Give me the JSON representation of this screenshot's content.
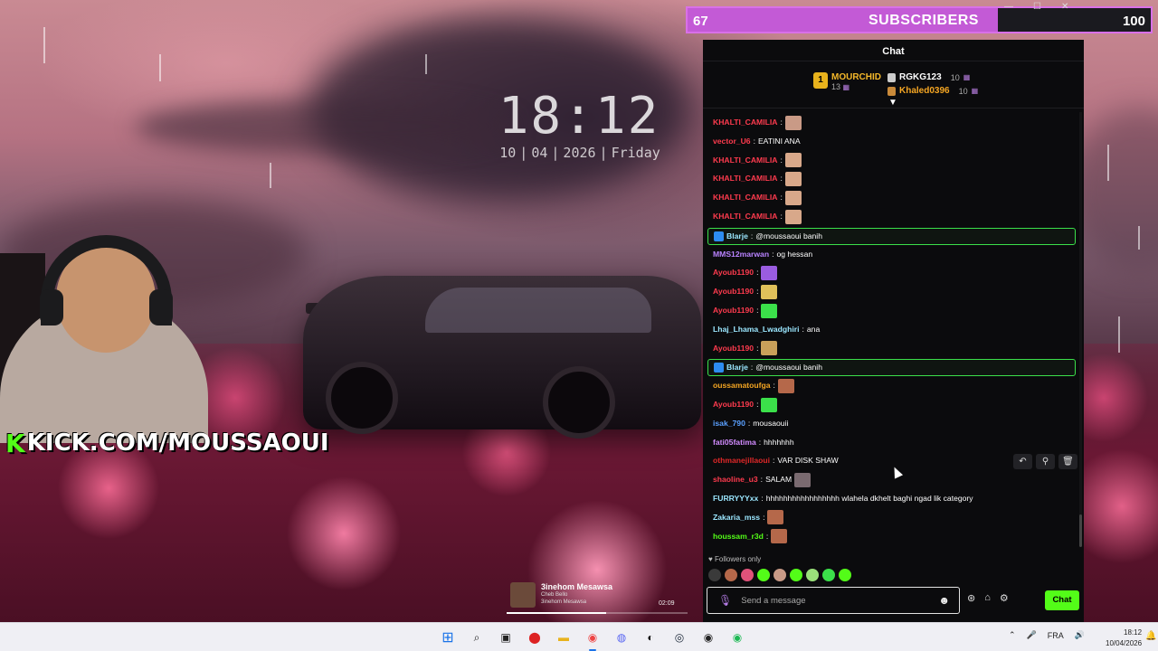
{
  "overlay": {
    "clock": {
      "time": "18:12",
      "day": "10",
      "month": "04",
      "year": "2026",
      "weekday": "Friday"
    },
    "brand": {
      "k_letter": "K",
      "text": "KICK.COM/MOUSSAOUI"
    },
    "sub_goal": {
      "current": "67",
      "label": "SUBSCRIBERS",
      "target": "100",
      "progress": 0.67
    },
    "music": {
      "title": "3inehom Mesawsa",
      "artist": "Cheb Bello",
      "album": "3inehom Mesawsa",
      "time": "02:09",
      "progress": 0.55
    }
  },
  "chat": {
    "header": "Chat",
    "leaderboard": {
      "first": {
        "rank": "1",
        "name": "MOURCHID",
        "count": "13",
        "color": "#f5b82a"
      },
      "second": {
        "name": "RGKG123",
        "count": "10",
        "color": "#ffffff"
      },
      "third": {
        "name": "Khaled0396",
        "count": "10",
        "color": "#f5a623"
      }
    },
    "messages": [
      {
        "user": "KHALTI_CAMILIA",
        "text": "",
        "color": "#ff3b4e",
        "emote": "#c99a86"
      },
      {
        "user": "vector_U6",
        "text": "EATINI ANA",
        "color": "#ff3b4e"
      },
      {
        "user": "KHALTI_CAMILIA",
        "text": "",
        "color": "#ff3b4e",
        "emote": "#d8a88a"
      },
      {
        "user": "KHALTI_CAMILIA",
        "text": "",
        "color": "#ff3b4e",
        "emote": "#d8a88a"
      },
      {
        "user": "KHALTI_CAMILIA",
        "text": "",
        "color": "#ff3b4e",
        "emote": "#d8a88a"
      },
      {
        "user": "KHALTI_CAMILIA",
        "text": "",
        "color": "#ff3b4e",
        "emote": "#d8a88a"
      },
      {
        "user": "Blarje",
        "text": "@moussaoui banih",
        "color": "#9be7ff",
        "highlight": true
      },
      {
        "user": "MMS12marwan",
        "text": "og hessan",
        "color": "#b983ff"
      },
      {
        "user": "Ayoub1190",
        "text": "",
        "color": "#ff3b4e",
        "emote": "#9a5ce0"
      },
      {
        "user": "Ayoub1190",
        "text": "",
        "color": "#ff3b4e",
        "emote": "#e0c05a"
      },
      {
        "user": "Ayoub1190",
        "text": "",
        "color": "#ff3b4e",
        "emote": "#3be04a"
      },
      {
        "user": "Lhaj_Lhama_Lwadghiri",
        "text": "ana",
        "color": "#9be7ff"
      },
      {
        "user": "Ayoub1190",
        "text": "",
        "color": "#ff3b4e",
        "emote": "#c9a05a"
      },
      {
        "user": "Blarje",
        "text": "@moussaoui banih",
        "color": "#9be7ff",
        "highlight": true
      },
      {
        "user": "oussamatoufga",
        "text": "",
        "color": "#f5a623",
        "emote": "#b5684a"
      },
      {
        "user": "Ayoub1190",
        "text": "",
        "color": "#ff3b4e",
        "emote": "#3be04a"
      },
      {
        "user": "isak_790",
        "text": "mousaouii",
        "color": "#5aa0ff"
      },
      {
        "user": "fati05fatima",
        "text": "hhhhhhh",
        "color": "#d28cff"
      },
      {
        "user": "othmanejillaoui",
        "text": "VAR DISK SHAW",
        "color": "#e02828"
      },
      {
        "user": "shaoline_u3",
        "text": "SALAM",
        "color": "#ff3b4e",
        "emote": "#7a6a70"
      },
      {
        "user": "FURRYYYxx",
        "text": "hhhhhhhhhhhhhhhhh wlahela dkhelt baghi ngad lik category",
        "color": "#9be7ff"
      },
      {
        "user": "Zakaria_mss",
        "text": "",
        "color": "#9be7ff",
        "emote": "#b5684a"
      },
      {
        "user": "houssam_r3d",
        "text": "",
        "color": "#53fc18",
        "emote": "#b5684a"
      }
    ],
    "followers_only": "Followers only",
    "input": {
      "placeholder": "Send a message"
    },
    "send_label": "Chat"
  },
  "taskbar": {
    "lang": "FRA",
    "time": "18:12",
    "date": "10/04/2026"
  }
}
